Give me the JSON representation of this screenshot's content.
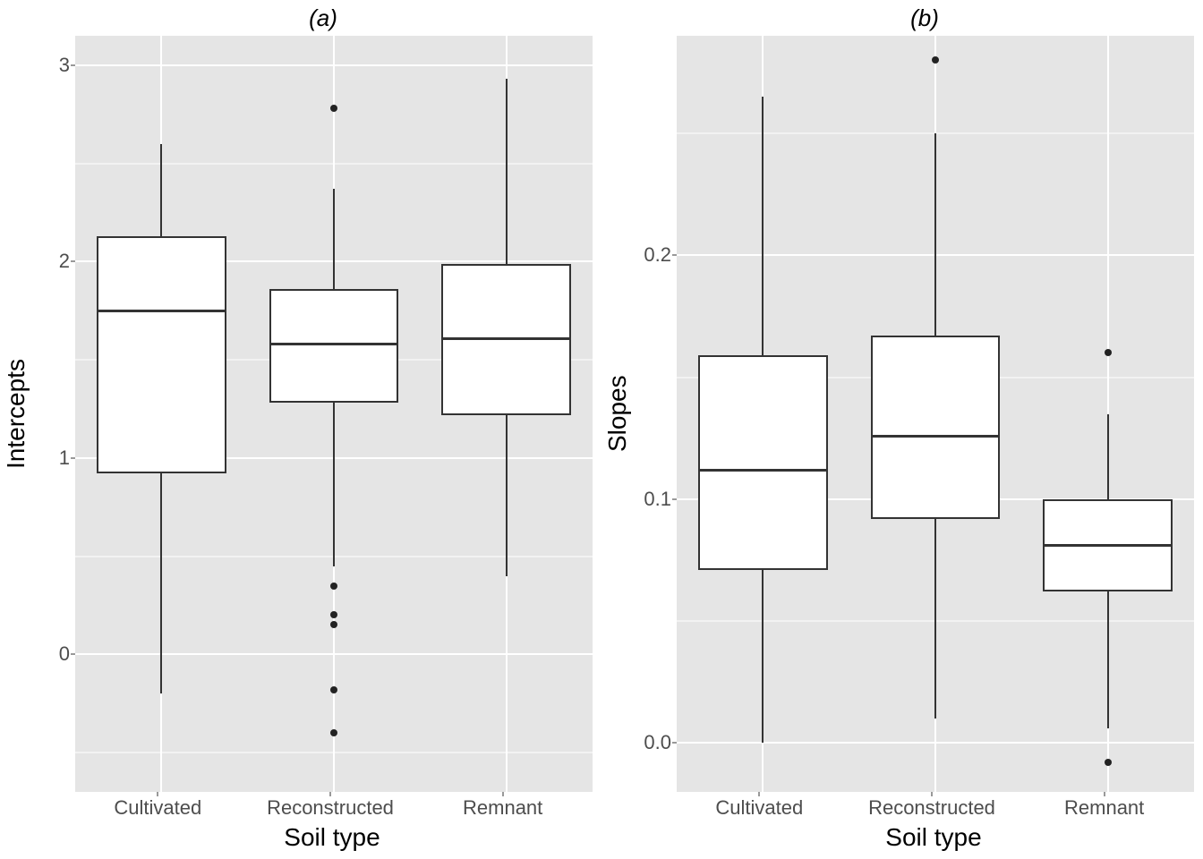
{
  "chart_data": [
    {
      "id": "a",
      "type": "boxplot",
      "title": "(a)",
      "xlabel": "Soil type",
      "ylabel": "Intercepts",
      "categories": [
        "Cultivated",
        "Reconstructed",
        "Remnant"
      ],
      "ylim": [
        -0.7,
        3.15
      ],
      "yticks_major": [
        0,
        1,
        2,
        3
      ],
      "yticks_minor": [
        -0.5,
        0.5,
        1.5,
        2.5
      ],
      "boxes": [
        {
          "category": "Cultivated",
          "min": -0.2,
          "q1": 0.92,
          "median": 1.75,
          "q3": 2.13,
          "max": 2.6,
          "outliers": []
        },
        {
          "category": "Reconstructed",
          "min": 0.45,
          "q1": 1.28,
          "median": 1.58,
          "q3": 1.86,
          "max": 2.37,
          "outliers": [
            2.78,
            0.35,
            0.2,
            0.15,
            -0.18,
            -0.4
          ]
        },
        {
          "category": "Remnant",
          "min": 0.4,
          "q1": 1.22,
          "median": 1.61,
          "q3": 1.99,
          "max": 2.93,
          "outliers": []
        }
      ]
    },
    {
      "id": "b",
      "type": "boxplot",
      "title": "(b)",
      "xlabel": "Soil type",
      "ylabel": "Slopes",
      "categories": [
        "Cultivated",
        "Reconstructed",
        "Remnant"
      ],
      "ylim": [
        -0.02,
        0.29
      ],
      "yticks_major": [
        0.0,
        0.1,
        0.2
      ],
      "yticks_minor": [
        0.05,
        0.15,
        0.25
      ],
      "boxes": [
        {
          "category": "Cultivated",
          "min": 0.0,
          "q1": 0.071,
          "median": 0.112,
          "q3": 0.159,
          "max": 0.265,
          "outliers": []
        },
        {
          "category": "Reconstructed",
          "min": 0.01,
          "q1": 0.092,
          "median": 0.126,
          "q3": 0.167,
          "max": 0.25,
          "outliers": [
            0.28
          ]
        },
        {
          "category": "Remnant",
          "min": 0.006,
          "q1": 0.062,
          "median": 0.081,
          "q3": 0.1,
          "max": 0.135,
          "outliers": [
            0.16,
            -0.008
          ]
        }
      ]
    }
  ]
}
